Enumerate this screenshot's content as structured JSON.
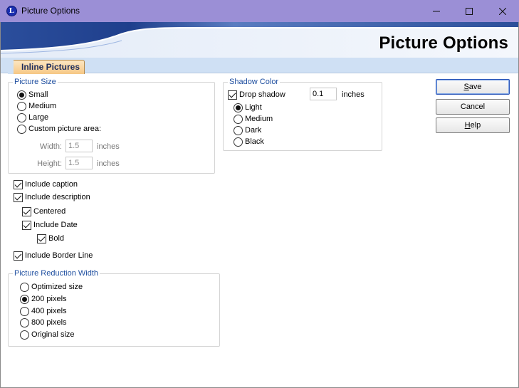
{
  "window": {
    "title": "Picture Options",
    "app_icon_letter": "L"
  },
  "banner": {
    "title": "Picture Options"
  },
  "tabs": [
    {
      "label": "Inline Pictures",
      "active": true
    }
  ],
  "picture_size": {
    "title": "Picture Size",
    "options": [
      {
        "label": "Small",
        "selected": true
      },
      {
        "label": "Medium",
        "selected": false
      },
      {
        "label": "Large",
        "selected": false
      },
      {
        "label": "Custom picture area:",
        "selected": false
      }
    ],
    "width": {
      "label": "Width:",
      "value": "1.5",
      "unit": "inches"
    },
    "height": {
      "label": "Height:",
      "value": "1.5",
      "unit": "inches"
    }
  },
  "checkboxes": {
    "include_caption": {
      "label": "Include caption",
      "checked": true
    },
    "include_description": {
      "label": "Include description",
      "checked": true
    },
    "centered": {
      "label": "Centered",
      "checked": true
    },
    "include_date": {
      "label": "Include Date",
      "checked": true
    },
    "bold": {
      "label": "Bold",
      "checked": true
    },
    "include_border": {
      "label": "Include Border Line",
      "checked": true
    }
  },
  "reduction": {
    "title": "Picture Reduction Width",
    "options": [
      {
        "label": "Optimized size",
        "selected": false
      },
      {
        "label": "200 pixels",
        "selected": true
      },
      {
        "label": "400 pixels",
        "selected": false
      },
      {
        "label": "800 pixels",
        "selected": false
      },
      {
        "label": "Original size",
        "selected": false
      }
    ]
  },
  "shadow": {
    "title": "Shadow Color",
    "drop_shadow": {
      "label": "Drop shadow",
      "checked": true,
      "value": "0.1",
      "unit": "inches"
    },
    "options": [
      {
        "label": "Light",
        "selected": true
      },
      {
        "label": "Medium",
        "selected": false
      },
      {
        "label": "Dark",
        "selected": false
      },
      {
        "label": "Black",
        "selected": false
      }
    ]
  },
  "buttons": {
    "save": {
      "mnemonic": "S",
      "rest": "ave"
    },
    "cancel": {
      "label": "Cancel"
    },
    "help": {
      "mnemonic": "H",
      "rest": "elp"
    }
  },
  "colors": {
    "titlebar": "#9b8fd6",
    "banner_dark": "#1f3f8c",
    "banner_light": "#e7effa",
    "tab_bg": "#f6c784",
    "group_title": "#1f4fa0"
  },
  "icons": [
    "app-icon",
    "minimize-icon",
    "maximize-icon",
    "close-icon"
  ]
}
